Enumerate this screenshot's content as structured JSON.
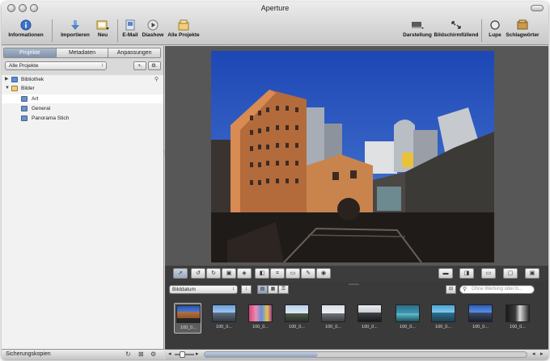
{
  "window": {
    "title": "Aperture"
  },
  "toolbar": {
    "items": [
      {
        "label": "Informationen",
        "icon": "info-icon"
      },
      {
        "label": "Importieren",
        "icon": "import-arrow-icon"
      },
      {
        "label": "Neu",
        "icon": "new-item-icon"
      },
      {
        "label": "E-Mail",
        "icon": "email-icon"
      },
      {
        "label": "Diashow",
        "icon": "play-icon"
      },
      {
        "label": "Alle Projekte",
        "icon": "all-projects-icon"
      },
      {
        "label": "Darstellung",
        "icon": "layout-icon"
      },
      {
        "label": "Bildschirmfüllend",
        "icon": "fullscreen-icon"
      },
      {
        "label": "Lupe",
        "icon": "loupe-icon"
      },
      {
        "label": "Schlagwörter",
        "icon": "keywords-icon"
      }
    ]
  },
  "sidebar": {
    "tabs": [
      {
        "label": "Projekte",
        "active": true
      },
      {
        "label": "Metadaten",
        "active": false
      },
      {
        "label": "Anpassungen",
        "active": false
      }
    ],
    "filter": {
      "value": "Alle Projekte",
      "add_label": "+.",
      "gear_label": "⚙."
    },
    "tree": [
      {
        "label": "Bibliothek",
        "icon": "library-icon",
        "level": 0,
        "expanded": false,
        "selected": false
      },
      {
        "label": "Bilder",
        "icon": "folder-icon",
        "level": 0,
        "expanded": true,
        "selected": false
      },
      {
        "label": "Art",
        "icon": "album-icon",
        "level": 1,
        "selected": true
      },
      {
        "label": "General",
        "icon": "album-icon",
        "level": 1,
        "selected": false
      },
      {
        "label": "Panorama Stich",
        "icon": "album-icon",
        "level": 1,
        "selected": false
      }
    ],
    "footer": {
      "label": "Sicherungskopien"
    }
  },
  "browser": {
    "sort": {
      "value": "Bilddatum"
    },
    "search": {
      "placeholder": "Ohne Wertung oder b..."
    },
    "thumbnails": [
      {
        "caption": "100_0...",
        "selected": true
      },
      {
        "caption": "100_0...",
        "selected": false
      },
      {
        "caption": "100_0...",
        "selected": false
      },
      {
        "caption": "100_0...",
        "selected": false
      },
      {
        "caption": "100_0...",
        "selected": false
      },
      {
        "caption": "100_0...",
        "selected": false
      },
      {
        "caption": "100_0...",
        "selected": false
      },
      {
        "caption": "100_0...",
        "selected": false
      },
      {
        "caption": "100_0...",
        "selected": false
      },
      {
        "caption": "100_0...",
        "selected": false
      }
    ]
  },
  "colors": {
    "selection": "#ffffff",
    "tab_active": "#8497b1",
    "viewer_bg": "#575757",
    "browser_bg": "#3a3a3a"
  }
}
